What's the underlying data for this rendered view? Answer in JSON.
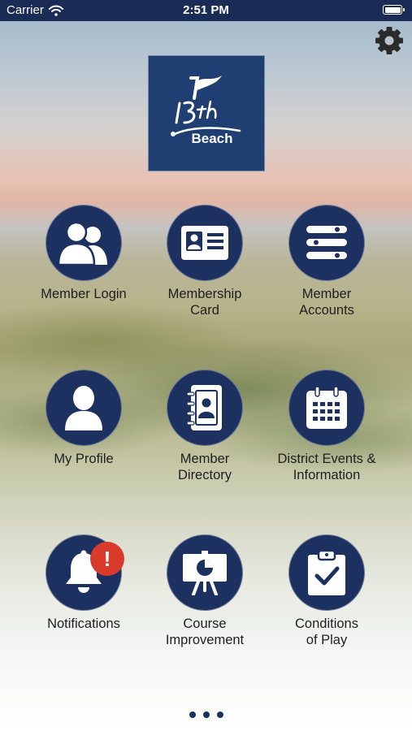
{
  "status_bar": {
    "carrier": "Carrier",
    "time": "2:51 PM"
  },
  "logo": {
    "text": "Beach",
    "number": "13th"
  },
  "menu": [
    {
      "label": "Member Login",
      "icon": "members-icon"
    },
    {
      "label": "Membership\nCard",
      "icon": "id-card-icon"
    },
    {
      "label": "Member\nAccounts",
      "icon": "accounts-list-icon"
    },
    {
      "label": "My Profile",
      "icon": "profile-icon"
    },
    {
      "label": "Member\nDirectory",
      "icon": "address-book-icon"
    },
    {
      "label": "District Events &\nInformation",
      "icon": "calendar-icon"
    },
    {
      "label": "Notifications",
      "icon": "bell-icon",
      "badge": "!"
    },
    {
      "label": "Course\nImprovement",
      "icon": "presentation-board-icon"
    },
    {
      "label": "Conditions\nof Play",
      "icon": "clipboard-check-icon"
    }
  ],
  "pager": {
    "pages": 3
  },
  "colors": {
    "navy": "#1d3160",
    "badge": "#d83b2c",
    "status_bar": "#1a2c55"
  }
}
